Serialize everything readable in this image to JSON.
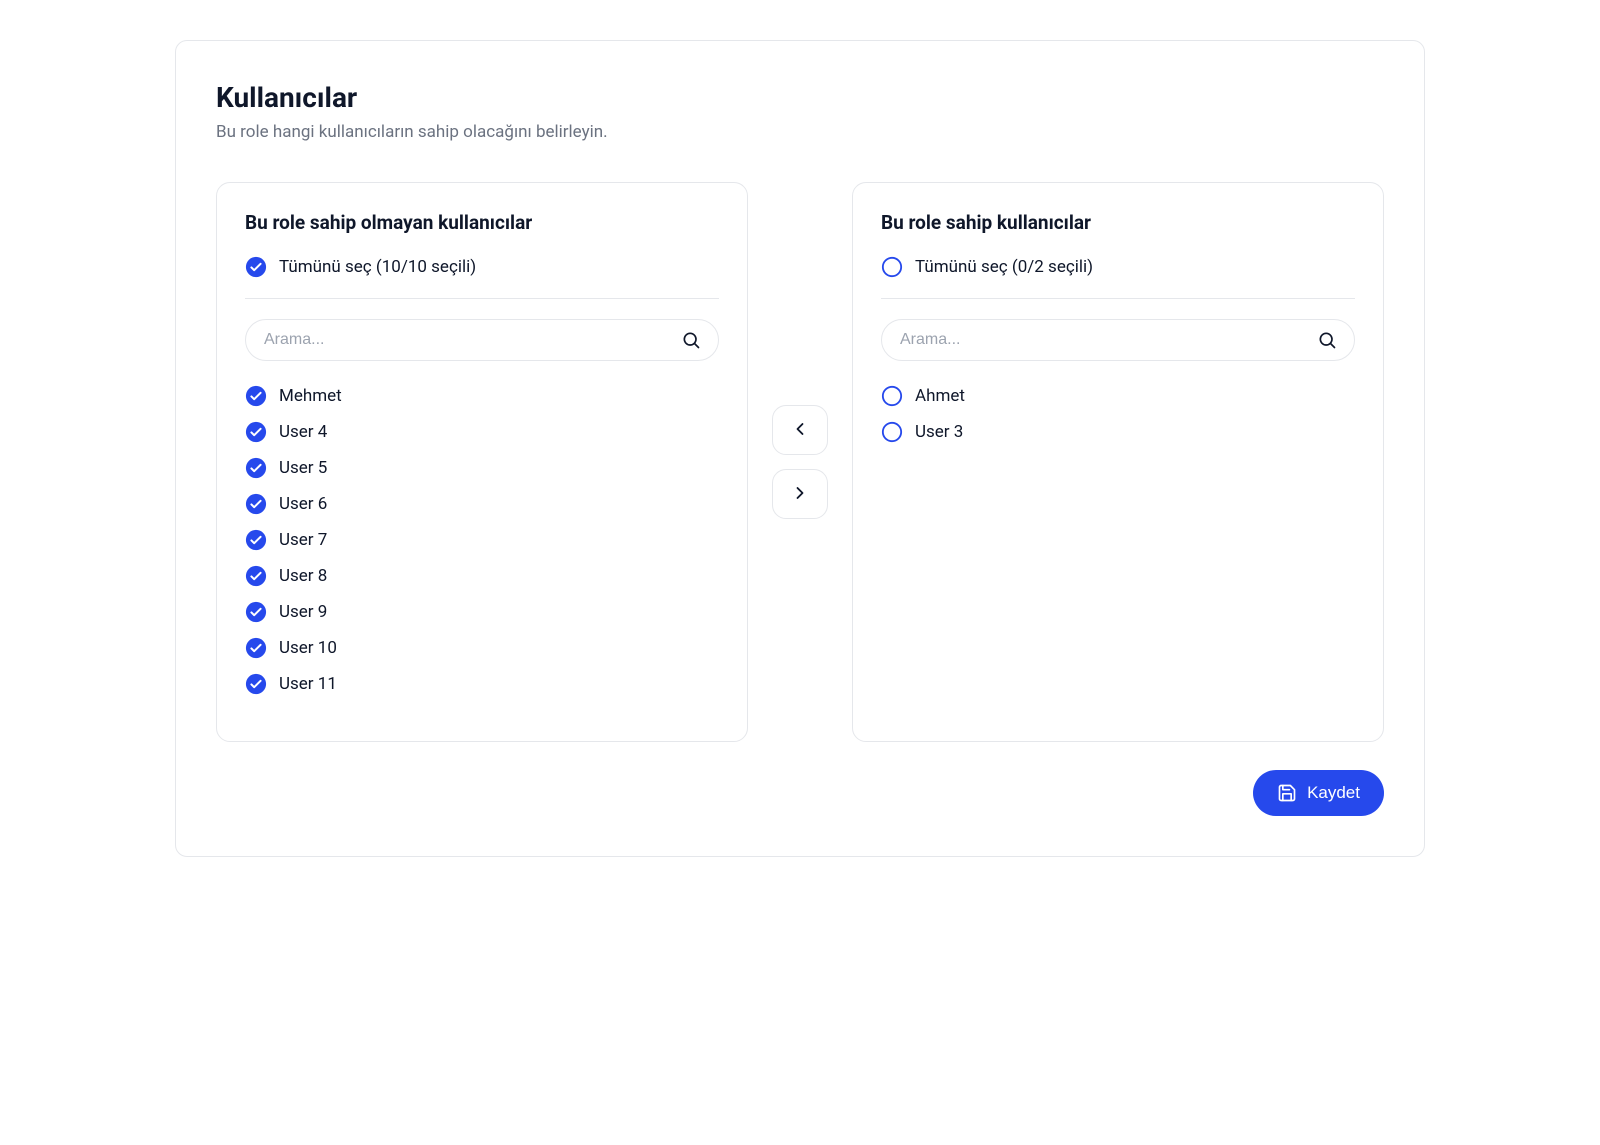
{
  "header": {
    "title": "Kullanıcılar",
    "subtitle": "Bu role hangi kullanıcıların sahip olacağını belirleyin."
  },
  "left_panel": {
    "title": "Bu role sahip olmayan kullanıcılar",
    "select_all_label": "Tümünü seç (10/10 seçili)",
    "select_all_checked": true,
    "search_placeholder": "Arama...",
    "items": [
      {
        "label": "Mehmet",
        "checked": true
      },
      {
        "label": "User 4",
        "checked": true
      },
      {
        "label": "User 5",
        "checked": true
      },
      {
        "label": "User 6",
        "checked": true
      },
      {
        "label": "User 7",
        "checked": true
      },
      {
        "label": "User 8",
        "checked": true
      },
      {
        "label": "User 9",
        "checked": true
      },
      {
        "label": "User 10",
        "checked": true
      },
      {
        "label": "User 11",
        "checked": true
      }
    ]
  },
  "right_panel": {
    "title": "Bu role sahip kullanıcılar",
    "select_all_label": "Tümünü seç (0/2 seçili)",
    "select_all_checked": false,
    "search_placeholder": "Arama...",
    "items": [
      {
        "label": "Ahmet",
        "checked": false
      },
      {
        "label": "User 3",
        "checked": false
      }
    ]
  },
  "buttons": {
    "save": "Kaydet"
  },
  "colors": {
    "primary": "#2649ec"
  }
}
